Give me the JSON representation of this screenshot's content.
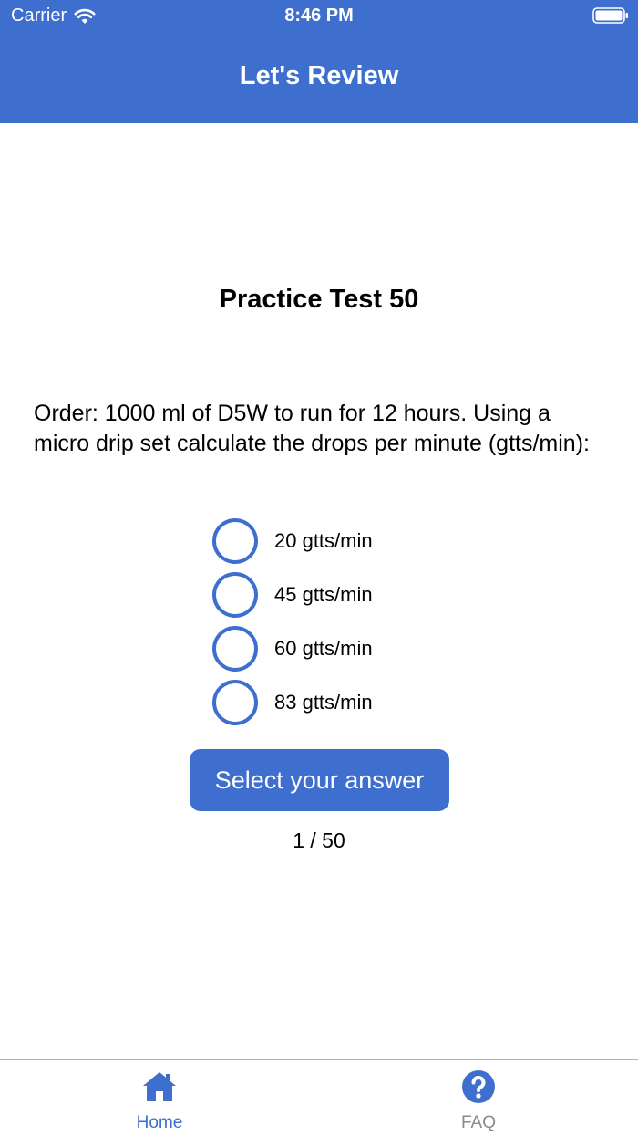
{
  "status_bar": {
    "carrier": "Carrier",
    "time": "8:46 PM"
  },
  "nav": {
    "title": "Let's Review"
  },
  "quiz": {
    "title": "Practice Test 50",
    "question": "Order: 1000 ml of D5W to run for 12 hours. Using a micro drip set calculate the drops per minute (gtts/min):",
    "options": [
      {
        "label": "20 gtts/min"
      },
      {
        "label": "45 gtts/min"
      },
      {
        "label": "60 gtts/min"
      },
      {
        "label": "83 gtts/min"
      }
    ],
    "submit_label": "Select your answer",
    "progress": "1 / 50"
  },
  "tabs": [
    {
      "label": "Home",
      "icon": "home-icon"
    },
    {
      "label": "FAQ",
      "icon": "question-circle-icon"
    }
  ],
  "colors": {
    "accent": "#3e6fce",
    "inactive_tab": "#8a8a8a"
  }
}
